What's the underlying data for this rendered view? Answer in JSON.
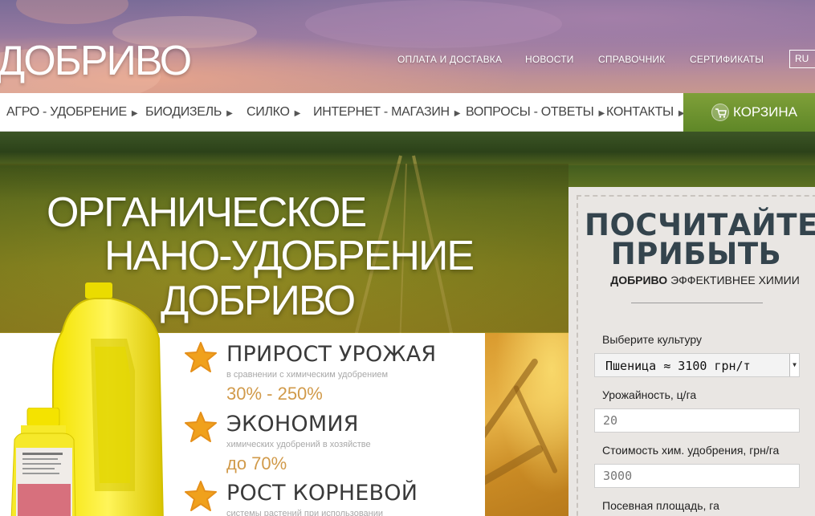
{
  "header": {
    "logo": "ДОБРИВО",
    "topnav": [
      "ОПЛАТА И ДОСТАВКА",
      "НОВОСТИ",
      "СПРАВОЧНИК",
      "СЕРТИФИКАТЫ"
    ],
    "language": "RU"
  },
  "mainnav": {
    "items": [
      "АГРО - УДОБРЕНИЕ",
      "БИОДИЗЕЛЬ",
      "СИЛКО",
      "ИНТЕРНЕТ - МАГАЗИН",
      "ВОПРОСЫ - ОТВЕТЫ",
      "КОНТАКТЫ"
    ],
    "cart_label": "КОРЗИНА"
  },
  "hero": {
    "line1": "ОРГАНИЧЕСКОЕ",
    "line2": "НАНО-УДОБРЕНИЕ",
    "line3": "ДОБРИВО"
  },
  "benefits": [
    {
      "title": "ПРИРОСТ УРОЖАЯ",
      "subtitle": "в сравнении с химическим удобрением",
      "value": "30% - 250%"
    },
    {
      "title": "ЭКОНОМИЯ",
      "subtitle": "химических удобрений в хозяйстве",
      "value": "до 70%"
    },
    {
      "title": "РОСТ КОРНЕВОЙ",
      "subtitle": "системы растений при использовании",
      "value": ""
    }
  ],
  "calculator": {
    "heading_line1": "ПОСЧИТАЙТЕ",
    "heading_line2": "ПРИБЫТЬ",
    "tagline_bold": "ДОБРИВО",
    "tagline_rest": " ЭФФЕКТИВНЕЕ ХИМИИ",
    "crop_label": "Выберите культуру",
    "crop_selected": "Пшеница ≈ 3100 грн/т",
    "yield_label": "Урожайность, ц/га",
    "yield_value": "20",
    "chem_cost_label": "Стоимость хим. удобрения, грн/га",
    "chem_cost_value": "3000",
    "area_label": "Посевная площадь, га"
  },
  "colors": {
    "cart_green": "#6b9130",
    "accent_value": "#d19a4a",
    "star": "#f0a11c",
    "calc_heading": "#34444d"
  }
}
